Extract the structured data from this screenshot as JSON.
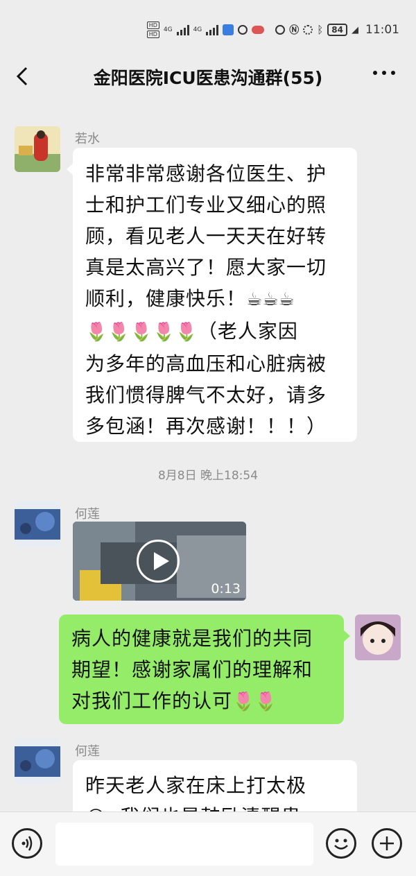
{
  "status_bar": {
    "sim1": "HD",
    "sim2": "HD",
    "network1": "4G",
    "network2": "4G",
    "battery": "84",
    "time": "11:01"
  },
  "header": {
    "title": "金阳医院ICU医患沟通群(55)"
  },
  "messages": [
    {
      "sender": "若水",
      "lines": [
        "非常非常感谢各位医生、护",
        "士和护工们专业又细心的照",
        "顾，看见老人一天天在好转",
        "真是太高兴了！愿大家一切",
        "顺利，健康快乐！",
        "（老人家因",
        "为多年的高血压和心脏病被",
        "我们惯得脾气不太好，请多",
        "多包涵！再次感谢！！！）"
      ],
      "emoji_coffee": "☕☕☕",
      "emoji_tulips": "🌷🌷🌷🌷🌷"
    },
    {
      "timestamp": "8月8日 晚上18:54"
    },
    {
      "sender": "何莲",
      "video_duration": "0:13"
    },
    {
      "lines": [
        "病人的健康就是我们的共同",
        "期望！感谢家属们的理解和",
        "对我们工作的认可"
      ],
      "emoji_tulips": "🌷🌷"
    },
    {
      "sender": "何莲",
      "lines": [
        "昨天老人家在床上打太极",
        "我们也是鼓励清醒患"
      ],
      "emoji_face": "😂"
    }
  ],
  "input": {
    "value": ""
  },
  "colors": {
    "background": "#ededed",
    "self_bubble": "#95ec69",
    "other_bubble": "#ffffff"
  }
}
